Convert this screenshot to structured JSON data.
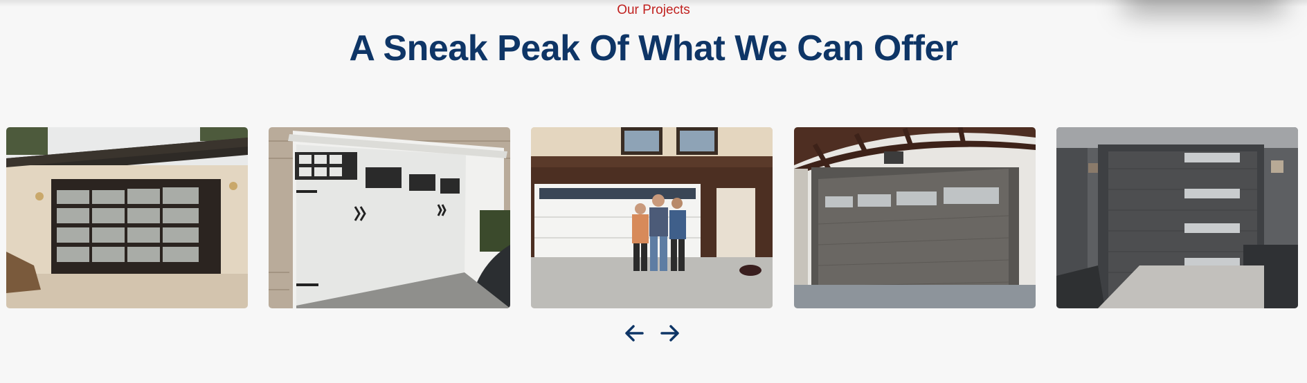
{
  "section": {
    "eyebrow": "Our Projects",
    "title": "A Sneak Peak Of What We Can Offer"
  },
  "gallery": {
    "images": [
      {
        "subject": "beige house with dark-framed frosted glass garage door"
      },
      {
        "subject": "white carriage-style garage door with window panels"
      },
      {
        "subject": "three people standing in front of a white garage door"
      },
      {
        "subject": "charcoal garage door with glass top panels under pergola"
      },
      {
        "subject": "modern dark horizontal-plank garage door with glass slits"
      }
    ],
    "controls": {
      "prev_icon": "arrow-left-icon",
      "next_icon": "arrow-right-icon"
    }
  },
  "colors": {
    "accent": "#c0211f",
    "heading": "#0e3566",
    "background": "#f7f7f7"
  }
}
